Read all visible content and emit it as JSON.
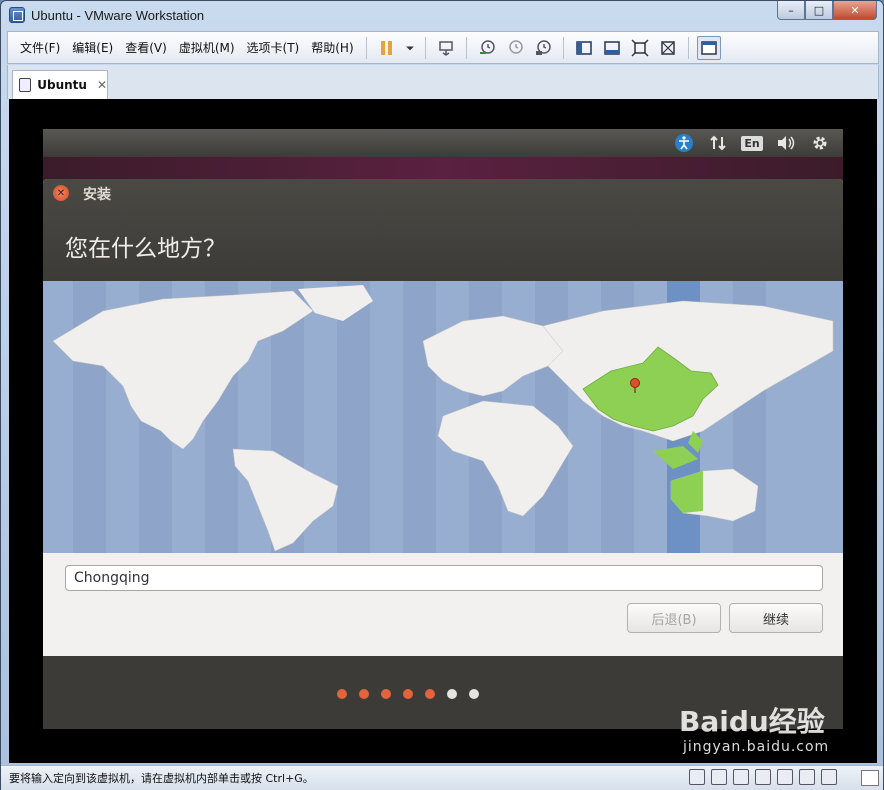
{
  "window": {
    "title": "Ubuntu - VMware Workstation",
    "controls": {
      "minimize": "–",
      "maximize": "□",
      "close": "✕"
    }
  },
  "menubar": {
    "items": [
      "文件(F)",
      "编辑(E)",
      "查看(V)",
      "虚拟机(M)",
      "选项卡(T)",
      "帮助(H)"
    ]
  },
  "toolbar": {
    "icons": [
      "pause-icon",
      "dropdown-icon",
      "send-ctrl-alt-del-icon",
      "snapshot-icon",
      "revert-snapshot-icon",
      "snapshot-manager-icon",
      "library-icon",
      "thumbnail-bar-icon",
      "full-screen-icon",
      "unity-icon",
      "console-view-icon"
    ]
  },
  "tabs": [
    {
      "label": "Ubuntu",
      "close": "✕"
    }
  ],
  "guest": {
    "topbar": {
      "keyboard_badge": "En"
    },
    "dialog": {
      "title": "安装",
      "close_glyph": "✕",
      "question": "您在什么地方？",
      "location_value": "Chongqing",
      "back_button": "后退(B)",
      "continue_button": "继续"
    },
    "progress": {
      "completed": 5,
      "total": 7
    }
  },
  "statusbar": {
    "text": "要将输入定向到该虚拟机，请在虚拟机内部单击或按 Ctrl+G。"
  },
  "watermark": {
    "logo": "Baidu经验",
    "url": "jingyan.baidu.com"
  },
  "colors": {
    "accent_orange": "#e2643a",
    "highlight_green": "#8ed054",
    "ocean": "#98aed0",
    "land": "#f1efed"
  }
}
